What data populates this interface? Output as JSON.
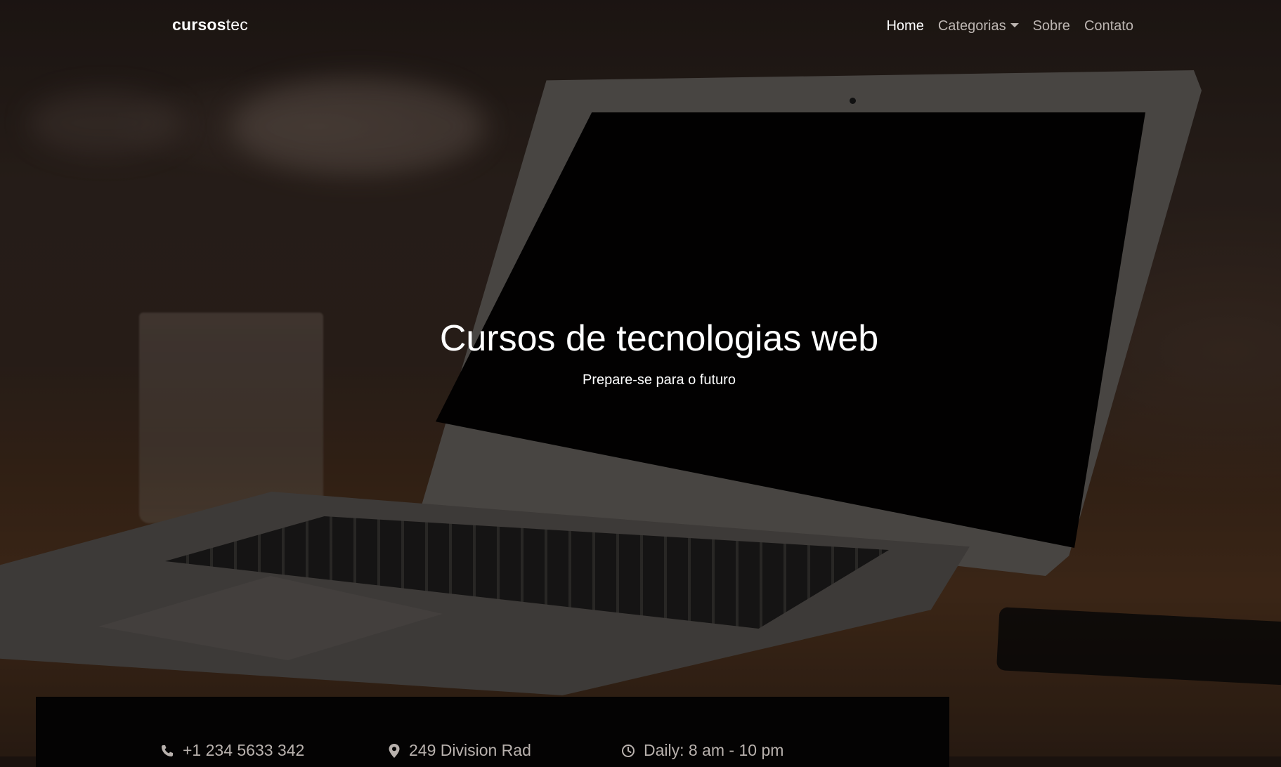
{
  "brand": {
    "bold": "cursos",
    "rest": "tec"
  },
  "nav": {
    "items": [
      {
        "label": "Home",
        "active": true
      },
      {
        "label": "Categorias",
        "dropdown": true
      },
      {
        "label": "Sobre"
      },
      {
        "label": "Contato"
      }
    ]
  },
  "hero": {
    "title": "Cursos de tecnologias web",
    "subtitle": "Prepare-se para o futuro"
  },
  "info": [
    {
      "icon": "phone-icon",
      "text": "+1 234 5633 342"
    },
    {
      "icon": "location-pin-icon",
      "text": "249 Division Rad"
    },
    {
      "icon": "clock-icon",
      "text": "Daily: 8 am - 10 pm"
    }
  ],
  "colors": {
    "nav_active": "#ffffff",
    "nav_inactive": "#bdb6b2",
    "info_bar_bg": "#040303",
    "info_text": "#b8b1ad"
  }
}
